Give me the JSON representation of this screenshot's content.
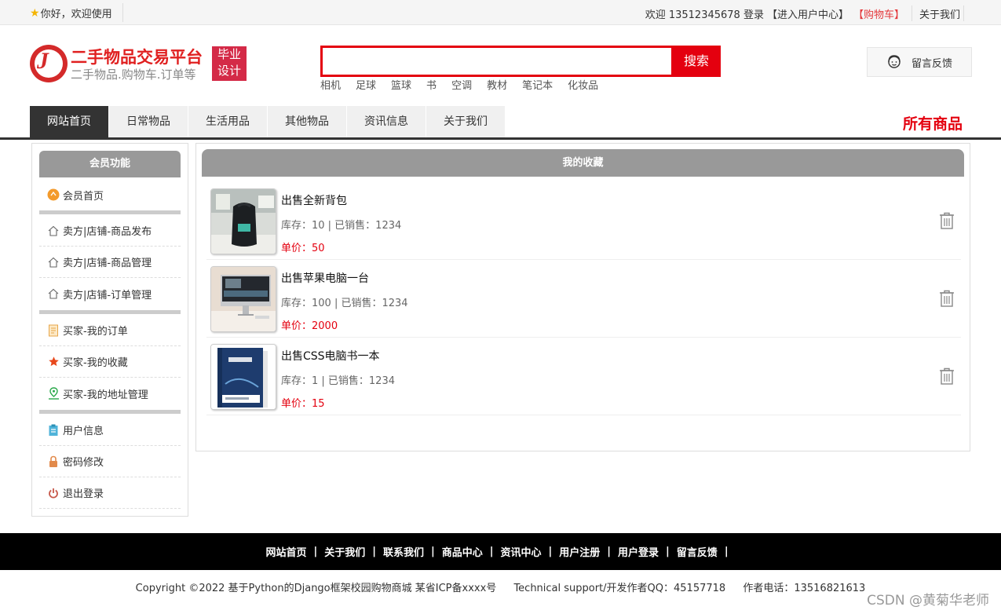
{
  "topbar": {
    "greeting": "你好，欢迎使用",
    "welcome_user": "欢迎 13512345678 登录",
    "user_center": "【进入用户中心】",
    "cart": "【购物车】",
    "about": "关于我们"
  },
  "brand": {
    "title": "二手物品交易平台",
    "subtitle": "二手物品.购物车.订单等",
    "badge_line1": "毕业",
    "badge_line2": "设计"
  },
  "search": {
    "value": "",
    "button": "搜索",
    "hotwords": [
      "相机",
      "足球",
      "篮球",
      "书",
      "空调",
      "教材",
      "笔记本",
      "化妆品"
    ]
  },
  "feedback_label": "留言反馈",
  "nav": {
    "items": [
      "网站首页",
      "日常物品",
      "生活用品",
      "其他物品",
      "资讯信息",
      "关于我们"
    ],
    "all_goods": "所有商品"
  },
  "sidebar": {
    "title": "会员功能",
    "items": [
      "会员首页",
      "卖方|店铺-商品发布",
      "卖方|店铺-商品管理",
      "卖方|店铺-订单管理",
      "买家-我的订单",
      "买家-我的收藏",
      "买家-我的地址管理",
      "用户信息",
      "密码修改",
      "退出登录"
    ]
  },
  "favorites": {
    "title": "我的收藏",
    "items": [
      {
        "name": "出售全新背包",
        "stock": "库存：10 | 已销售：1234",
        "price": "单价：50"
      },
      {
        "name": "出售苹果电脑一台",
        "stock": "库存：100 | 已销售：1234",
        "price": "单价：2000"
      },
      {
        "name": "出售CSS电脑书一本",
        "stock": "库存：1 | 已销售：1234",
        "price": "单价：15"
      }
    ]
  },
  "footer": {
    "links": [
      "网站首页",
      "关于我们",
      "联系我们",
      "商品中心",
      "资讯中心",
      "用户注册",
      "用户登录",
      "留言反馈"
    ],
    "sep": "|",
    "copyright": "Copyright ©2022 基于Python的Django框架校园购物商城 某省ICP备xxxx号",
    "support": "Technical support/开发作者QQ：45157718",
    "phone": "作者电话：13516821613"
  },
  "watermark": "CSDN @黄菊华老师",
  "colors": {
    "accent": "#e4000f",
    "nav_active": "#333333",
    "panel_head": "#999999"
  }
}
